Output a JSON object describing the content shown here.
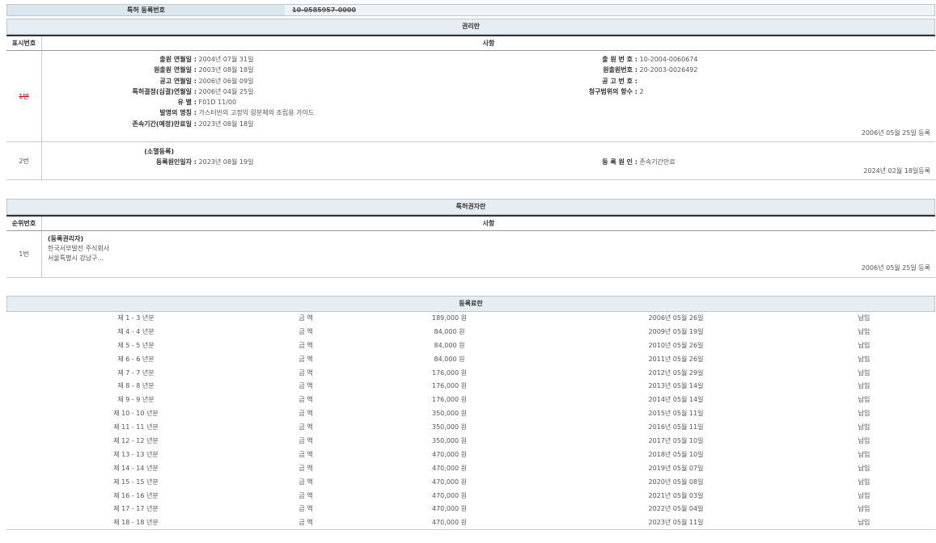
{
  "top": {
    "label": "특허 등록번호",
    "value": "10-0585957-0000"
  },
  "rights": {
    "header": "권리란",
    "col_num": "표시번호",
    "col_desc": "사항",
    "rows": [
      {
        "num": "1번",
        "left": [
          {
            "k": "출원 연월일 :",
            "v": "2004년 07월 31일"
          },
          {
            "k": "원출원 연월일 :",
            "v": "2003년 08월 18일"
          },
          {
            "k": "공고 연월일 :",
            "v": "2006년 06월 09일"
          },
          {
            "k": "특허결정(심결)연월일 :",
            "v": "2006년 04월 25일"
          },
          {
            "k": "유 별 :",
            "v": "F01D 11/00"
          },
          {
            "k": "발명의 명칭 :",
            "v": "가스터빈의 고정익 링분체의 조립용 가이드"
          },
          {
            "k": "존속기간(예정)만료일 :",
            "v": "2023년 08월 18일"
          }
        ],
        "right": [
          {
            "k": "출 원 번 호 :",
            "v": "10-2004-0060674"
          },
          {
            "k": "원출원번호 :",
            "v": "20-2003-0026492"
          },
          {
            "k": "공 고 번 호 :",
            "v": ""
          },
          {
            "k": "청구범위의 항수 :",
            "v": "2"
          }
        ],
        "regdate": "2006년 05월 25일 등록"
      },
      {
        "num": "2번",
        "title": "(소멸등록)",
        "left": [
          {
            "k": "등록원인일자 :",
            "v": "2023년 08월 19일"
          }
        ],
        "right": [
          {
            "k": "등 록 원 인 :",
            "v": "존속기간만료"
          }
        ],
        "regdate": "2024년 02월 18일등록"
      }
    ]
  },
  "holder": {
    "header": "특허권자란",
    "col_num": "순위번호",
    "col_desc": "사항",
    "row": {
      "num": "1번",
      "title": "(등록권리자)",
      "name": "한국서부발전 주식회사",
      "address": "서울특별시 강남구...",
      "regdate": "2006년 05월 25일 등록"
    }
  },
  "fees": {
    "header": "등록료란",
    "rows": [
      {
        "period": "제 1 - 3 년분",
        "label": "금 액",
        "amount": "189,000 원",
        "date": "2006년 05월 26일",
        "status": "납입"
      },
      {
        "period": "제 4 - 4 년분",
        "label": "금 액",
        "amount": "84,000 원",
        "date": "2009년 05월 19일",
        "status": "납입"
      },
      {
        "period": "제 5 - 5 년분",
        "label": "금 액",
        "amount": "84,000 원",
        "date": "2010년 05월 26일",
        "status": "납입"
      },
      {
        "period": "제 6 - 6 년분",
        "label": "금 액",
        "amount": "84,000 원",
        "date": "2011년 05월 26일",
        "status": "납입"
      },
      {
        "period": "제 7 - 7 년분",
        "label": "금 액",
        "amount": "176,000 원",
        "date": "2012년 05월 29일",
        "status": "납입"
      },
      {
        "period": "제 8 - 8 년분",
        "label": "금 액",
        "amount": "176,000 원",
        "date": "2013년 05월 14일",
        "status": "납입"
      },
      {
        "period": "제 9 - 9 년분",
        "label": "금 액",
        "amount": "176,000 원",
        "date": "2014년 05월 14일",
        "status": "납입"
      },
      {
        "period": "제 10 - 10 년분",
        "label": "금 액",
        "amount": "350,000 원",
        "date": "2015년 05월 11일",
        "status": "납입"
      },
      {
        "period": "제 11 - 11 년분",
        "label": "금 액",
        "amount": "350,000 원",
        "date": "2016년 05월 11일",
        "status": "납입"
      },
      {
        "period": "제 12 - 12 년분",
        "label": "금 액",
        "amount": "350,000 원",
        "date": "2017년 05월 10일",
        "status": "납입"
      },
      {
        "period": "제 13 - 13 년분",
        "label": "금 액",
        "amount": "470,000 원",
        "date": "2018년 05월 10일",
        "status": "납입"
      },
      {
        "period": "제 14 - 14 년분",
        "label": "금 액",
        "amount": "470,000 원",
        "date": "2019년 05월 07일",
        "status": "납입"
      },
      {
        "period": "제 15 - 15 년분",
        "label": "금 액",
        "amount": "470,000 원",
        "date": "2020년 05월 08일",
        "status": "납입"
      },
      {
        "period": "제 16 - 16 년분",
        "label": "금 액",
        "amount": "470,000 원",
        "date": "2021년 05월 03일",
        "status": "납입"
      },
      {
        "period": "제 17 - 17 년분",
        "label": "금 액",
        "amount": "470,000 원",
        "date": "2022년 05월 04일",
        "status": "납입"
      },
      {
        "period": "제 18 - 18 년분",
        "label": "금 액",
        "amount": "470,000 원",
        "date": "2023년 05월 11일",
        "status": "납입"
      }
    ]
  }
}
